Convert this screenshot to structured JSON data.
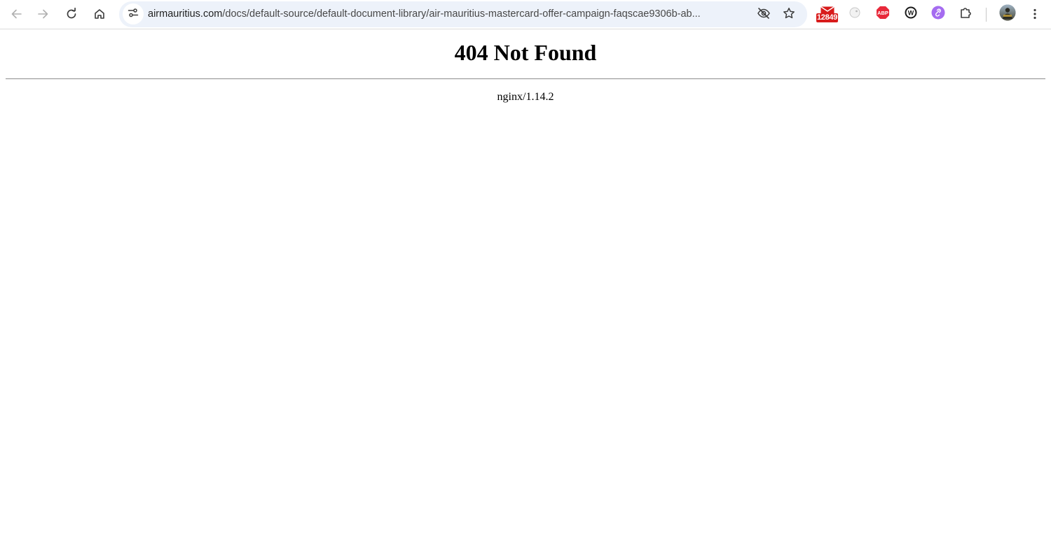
{
  "browser": {
    "url_domain": "airmauritius.com",
    "url_path": "/docs/default-source/default-document-library/air-mauritius-mastercard-offer-campaign-faqscae9306b-ab...",
    "nav_icons": [
      "back-arrow-icon",
      "forward-arrow-icon",
      "reload-icon",
      "home-icon"
    ],
    "omnibox_icons": [
      "site-info-icon",
      "eye-off-icon",
      "star-icon"
    ],
    "extensions": [
      {
        "name": "gmail-checker",
        "badge": "12849"
      },
      {
        "name": "extension-2"
      },
      {
        "name": "adblock-plus",
        "label": "ABP"
      },
      {
        "name": "extension-w",
        "label": "W"
      },
      {
        "name": "extension-purple"
      },
      {
        "name": "extensions-puzzle"
      }
    ],
    "colors": {
      "omnibox_bg": "#edf2fa",
      "abp_red": "#e8283a",
      "gmail_badge": "#d81b1b",
      "purple_ext": "#a56cf0"
    }
  },
  "page": {
    "heading": "404 Not Found",
    "server": "nginx/1.14.2"
  }
}
